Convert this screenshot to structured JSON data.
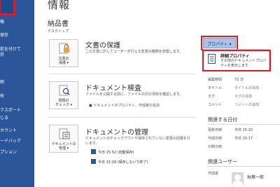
{
  "sidebar": {
    "items": [
      {
        "label": "報"
      },
      {
        "label": "保存"
      },
      {
        "label": "前を付けて"
      },
      {
        "label": "存"
      },
      {
        "label": "刷"
      },
      {
        "label": "有"
      },
      {
        "label": "クスポート"
      },
      {
        "label": "じる"
      },
      {
        "label": "カウント"
      },
      {
        "label": "ードバック"
      },
      {
        "label": "プション"
      }
    ],
    "item2b": "保存",
    "item3b": "存"
  },
  "main": {
    "title": "情報",
    "doc_name": "納品書",
    "doc_location": "デスクトップ"
  },
  "sections": [
    {
      "button": [
        "文書の",
        "保護 ▾"
      ],
      "title": "文書の保護",
      "desc": "この文書に対してユーザーが行える変更の種類を管理します。"
    },
    {
      "button": [
        "問題の",
        "チェック ▾"
      ],
      "title": "ドキュメント検査",
      "desc": "ファイルを公開する前に、ファイルの次の項目を確認します。",
      "bullet": "■ ドキュメントのプロパティ、作成者の名前"
    },
    {
      "button": [
        "ドキュメントの",
        "管理 ▾"
      ],
      "title": "ドキュメントの管理",
      "desc": "ドキュメントのチェックアウトや保存されていない変更の回復を行います。",
      "versions": [
        "今日 15:52 (自動保存)",
        "今日 15:18 (保存しないで終了)"
      ]
    }
  ],
  "properties": {
    "button_label": "プロパティ ▾",
    "menu": {
      "title": "詳細プロパティ",
      "desc": "その他のドキュメントプロパティを表示します"
    },
    "rows": [
      {
        "label": "編集時間",
        "value": "72 分"
      },
      {
        "label": "タイトル",
        "value": "タイトルの追加"
      },
      {
        "label": "タグ",
        "value": "タグの追加"
      },
      {
        "label": "コメント",
        "value": "コメントの追加"
      }
    ],
    "dates_head": "関連する日付",
    "dates": [
      {
        "label": "更新日時",
        "value": "今日 15:20"
      },
      {
        "label": "作成日時",
        "value": "今日 15:17"
      },
      {
        "label": "印刷日時",
        "value": ""
      }
    ],
    "users_head": "関連ユーザー",
    "author_label": "作成者",
    "author_name": "秋葉一郎"
  },
  "colors": {
    "sidebar": "#2b579a",
    "highlight": "#e8191e",
    "prop_button": "#a9c2e6"
  }
}
